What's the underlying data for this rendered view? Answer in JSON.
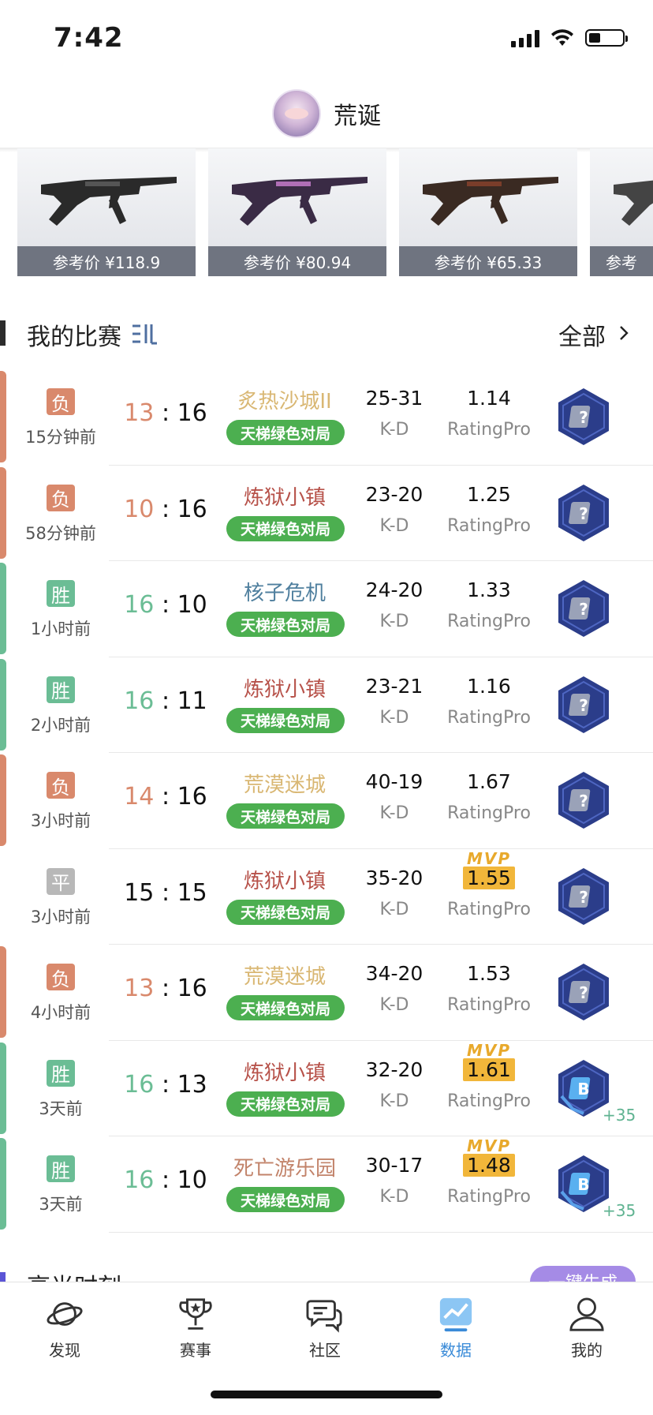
{
  "status_bar": {
    "time": "7:42"
  },
  "header": {
    "user_name": "荒诞"
  },
  "skins": [
    {
      "price": "参考价 ¥118.9",
      "gun_color": "#2a2a2a",
      "accent": "#555555"
    },
    {
      "price": "参考价 ¥80.94",
      "gun_color": "#3a2b45",
      "accent": "#b06fb6"
    },
    {
      "price": "参考价 ¥65.33",
      "gun_color": "#3a2a22",
      "accent": "#7a3d2a"
    },
    {
      "price": "参考",
      "gun_color": "#444444",
      "accent": "#888888"
    }
  ],
  "section": {
    "title": "我的比赛",
    "all_label": "全部"
  },
  "colors": {
    "loss": "#d9896c",
    "win": "#6bbd95",
    "draw": "#b8b8b8",
    "mode_green": "#4caf50",
    "rank_navy": "#2b3d8a"
  },
  "matches": [
    {
      "result": "负",
      "result_type": "loss",
      "time_ago": "15分钟前",
      "my_score": "13",
      "opp_score": "16",
      "sep": ":",
      "map": "炙热沙城II",
      "map_color": "#d9b773",
      "mode": "天梯绿色对局",
      "kd": "25-31",
      "kd_label": "K-D",
      "rating": "1.14",
      "rating_label": "RatingPro",
      "mvp": false,
      "rank": "unknown"
    },
    {
      "result": "负",
      "result_type": "loss",
      "time_ago": "58分钟前",
      "my_score": "10",
      "opp_score": "16",
      "sep": ":",
      "map": "炼狱小镇",
      "map_color": "#b7524a",
      "mode": "天梯绿色对局",
      "kd": "23-20",
      "kd_label": "K-D",
      "rating": "1.25",
      "rating_label": "RatingPro",
      "mvp": false,
      "rank": "unknown"
    },
    {
      "result": "胜",
      "result_type": "win",
      "time_ago": "1小时前",
      "my_score": "16",
      "opp_score": "10",
      "sep": ":",
      "map": "核子危机",
      "map_color": "#4f7f9e",
      "mode": "天梯绿色对局",
      "kd": "24-20",
      "kd_label": "K-D",
      "rating": "1.33",
      "rating_label": "RatingPro",
      "mvp": false,
      "rank": "unknown"
    },
    {
      "result": "胜",
      "result_type": "win",
      "time_ago": "2小时前",
      "my_score": "16",
      "opp_score": "11",
      "sep": ":",
      "map": "炼狱小镇",
      "map_color": "#b7524a",
      "mode": "天梯绿色对局",
      "kd": "23-21",
      "kd_label": "K-D",
      "rating": "1.16",
      "rating_label": "RatingPro",
      "mvp": false,
      "rank": "unknown"
    },
    {
      "result": "负",
      "result_type": "loss",
      "time_ago": "3小时前",
      "my_score": "14",
      "opp_score": "16",
      "sep": ":",
      "map": "荒漠迷城",
      "map_color": "#d9b773",
      "mode": "天梯绿色对局",
      "kd": "40-19",
      "kd_label": "K-D",
      "rating": "1.67",
      "rating_label": "RatingPro",
      "mvp": false,
      "rank": "unknown"
    },
    {
      "result": "平",
      "result_type": "draw",
      "time_ago": "3小时前",
      "my_score": "15",
      "opp_score": "15",
      "sep": ":",
      "map": "炼狱小镇",
      "map_color": "#b7524a",
      "mode": "天梯绿色对局",
      "kd": "35-20",
      "kd_label": "K-D",
      "rating": "1.55",
      "rating_label": "RatingPro",
      "mvp": true,
      "mvp_label": "MVP",
      "rank": "unknown"
    },
    {
      "result": "负",
      "result_type": "loss",
      "time_ago": "4小时前",
      "my_score": "13",
      "opp_score": "16",
      "sep": ":",
      "map": "荒漠迷城",
      "map_color": "#d9b773",
      "mode": "天梯绿色对局",
      "kd": "34-20",
      "kd_label": "K-D",
      "rating": "1.53",
      "rating_label": "RatingPro",
      "mvp": false,
      "rank": "unknown"
    },
    {
      "result": "胜",
      "result_type": "win",
      "time_ago": "3天前",
      "my_score": "16",
      "opp_score": "13",
      "sep": ":",
      "map": "炼狱小镇",
      "map_color": "#b7524a",
      "mode": "天梯绿色对局",
      "kd": "32-20",
      "kd_label": "K-D",
      "rating": "1.61",
      "rating_label": "RatingPro",
      "mvp": true,
      "mvp_label": "MVP",
      "rank": "B",
      "rank_delta": "+35"
    },
    {
      "result": "胜",
      "result_type": "win",
      "time_ago": "3天前",
      "my_score": "16",
      "opp_score": "10",
      "sep": ":",
      "map": "死亡游乐园",
      "map_color": "#c2836a",
      "mode": "天梯绿色对局",
      "kd": "30-17",
      "kd_label": "K-D",
      "rating": "1.48",
      "rating_label": "RatingPro",
      "mvp": true,
      "mvp_label": "MVP",
      "rank": "B",
      "rank_delta": "+35"
    }
  ],
  "next_section": {
    "title": "高光时刻",
    "pill": "一键生成"
  },
  "tabs": [
    {
      "label": "发现",
      "icon": "planet-icon",
      "active": false
    },
    {
      "label": "赛事",
      "icon": "trophy-icon",
      "active": false
    },
    {
      "label": "社区",
      "icon": "chat-bubbles-icon",
      "active": false
    },
    {
      "label": "数据",
      "icon": "chart-icon",
      "active": true
    },
    {
      "label": "我的",
      "icon": "profile-icon",
      "active": false
    }
  ]
}
